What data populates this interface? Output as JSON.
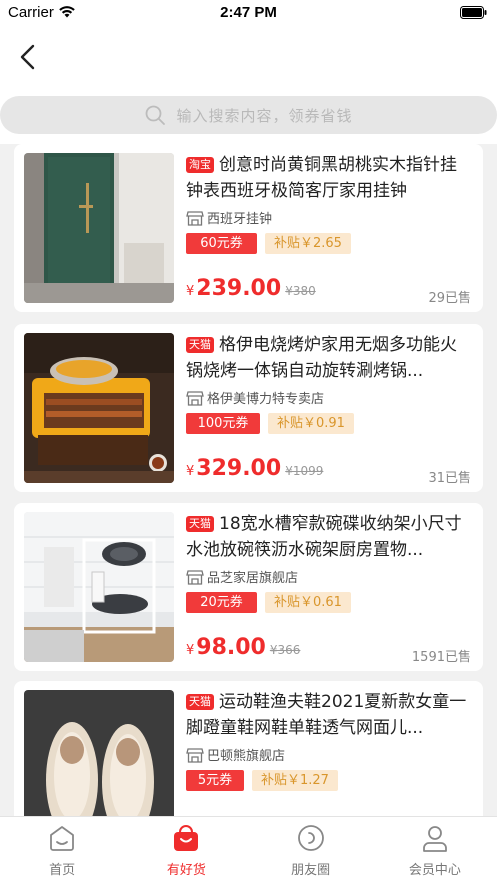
{
  "status_bar": {
    "carrier": "Carrier",
    "time": "2:47 PM"
  },
  "search": {
    "placeholder": "输入搜索内容，领券省钱"
  },
  "products": [
    {
      "platform": "淘宝",
      "title": "创意时尚黄铜黑胡桃实木指针挂钟表西班牙极简客厅家用挂钟",
      "shop": "西班牙挂钟",
      "coupon": "60元券",
      "subsidy": "补贴￥2.65",
      "yen": "¥",
      "price": "239.00",
      "original_price": "¥380",
      "sold": "29已售"
    },
    {
      "platform": "天猫",
      "title": "格伊电烧烤炉家用无烟多功能火锅烧烤一体锅自动旋转涮烤锅...",
      "shop": "格伊美博力特专卖店",
      "coupon": "100元券",
      "subsidy": "补贴￥0.91",
      "yen": "¥",
      "price": "329.00",
      "original_price": "¥1099",
      "sold": "31已售"
    },
    {
      "platform": "天猫",
      "title": "18宽水槽窄款碗碟收纳架小尺寸水池放碗筷沥水碗架厨房置物...",
      "shop": "品芝家居旗舰店",
      "coupon": "20元券",
      "subsidy": "补贴￥0.61",
      "yen": "¥",
      "price": "98.00",
      "original_price": "¥366",
      "sold": "1591已售"
    },
    {
      "platform": "天猫",
      "title": "运动鞋渔夫鞋2021夏新款女童一脚蹬童鞋网鞋单鞋透气网面儿...",
      "shop": "巴顿熊旗舰店",
      "coupon": "5元券",
      "subsidy": "补贴￥1.27",
      "yen": "",
      "price": "",
      "original_price": "",
      "sold": ""
    }
  ],
  "tabs": [
    {
      "label": "首页",
      "icon": "home-icon",
      "active": false
    },
    {
      "label": "有好货",
      "icon": "shopping-bag-icon",
      "active": true
    },
    {
      "label": "朋友圈",
      "icon": "circle-icon",
      "active": false
    },
    {
      "label": "会员中心",
      "icon": "user-icon",
      "active": false
    }
  ],
  "colors": {
    "accent": "#ef2c2c",
    "subsidy_bg": "#fbe8cf",
    "subsidy_text": "#d9962c",
    "background": "#f1f1f1"
  }
}
